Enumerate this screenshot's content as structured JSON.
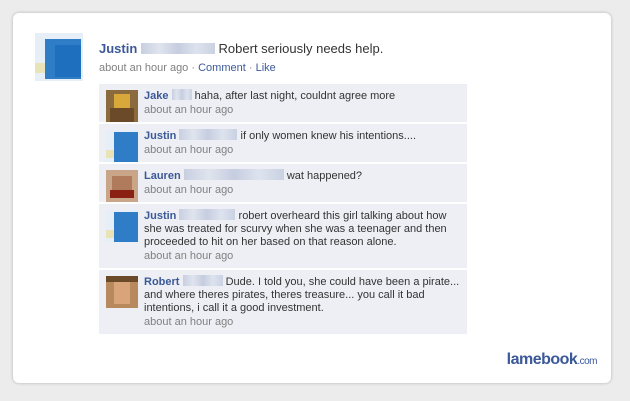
{
  "post": {
    "author": "Justin",
    "text": "Robert seriously needs help.",
    "time": "about an hour ago",
    "sep": "·",
    "comment_label": "Comment",
    "like_label": "Like"
  },
  "comments": [
    {
      "author": "Jake",
      "text": "haha, after last night, couldnt agree more",
      "time": "about an hour ago"
    },
    {
      "author": "Justin",
      "text": "if only women knew his intentions....",
      "time": "about an hour ago"
    },
    {
      "author": "Lauren",
      "text": "wat happened?",
      "time": "about an hour ago"
    },
    {
      "author": "Justin",
      "text": "robert overheard this girl talking about how she was treated for scurvy when she was a teenager and then proceeded to hit on her based on that reason alone.",
      "time": "about an hour ago"
    },
    {
      "author": "Robert",
      "text": "Dude. I told you, she could have been a pirate... and where theres pirates, theres treasure... you call it bad intentions, i call it a good investment.",
      "time": "about an hour ago"
    }
  ],
  "brand": {
    "name": "lamebook",
    "suffix": ".com"
  }
}
